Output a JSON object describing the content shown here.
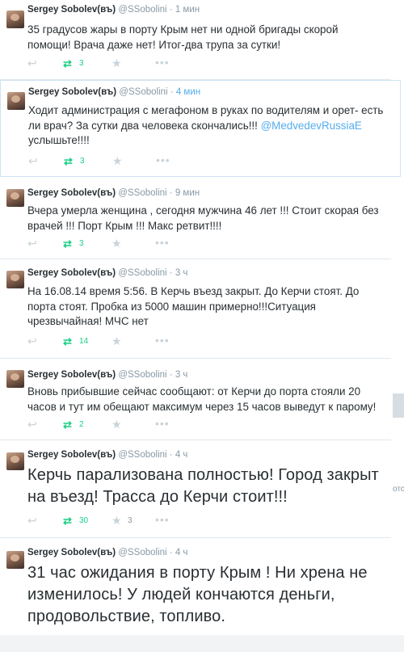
{
  "tweets": [
    {
      "name": "Sergey Sobolev(въ)",
      "handle": "@SSobolini",
      "time": "1 мин",
      "text": "35 градусов жары в порту Крым нет ни одной бригады скорой помощи! Врача даже нет! Итог-два трупа за сутки!",
      "retweets": "3",
      "favorites": ""
    },
    {
      "name": "Sergey Sobolev(въ)",
      "handle": "@SSobolini",
      "time": "4 мин",
      "text_before": "Ходит администрация с мегафоном в руках по водителям и орет- есть ли врач? За сутки два человека скончались!!! ",
      "mention": "@MedvedevRussiaE",
      "text_after": " услышьте!!!!",
      "retweets": "3",
      "favorites": ""
    },
    {
      "name": "Sergey Sobolev(въ)",
      "handle": "@SSobolini",
      "time": "9 мин",
      "text": "Вчера умерла женщина , сегодня мужчина 46 лет !!! Стоит скорая без врачей !!! Порт Крым !!! Макс ретвит!!!!",
      "retweets": "3",
      "favorites": ""
    },
    {
      "name": "Sergey Sobolev(въ)",
      "handle": "@SSobolini",
      "time": "3 ч",
      "text": "На 16.08.14 время 5:56. В Керчь въезд закрыт. До Керчи стоят. До порта стоят. Пробка из 5000 машин примерно!!!Ситуация чрезвычайная! МЧС нет",
      "retweets": "14",
      "favorites": ""
    },
    {
      "name": "Sergey Sobolev(въ)",
      "handle": "@SSobolini",
      "time": "3 ч",
      "text": "Вновь прибывшие сейчас сообщают: от Керчи до порта стояли 20 часов и тут им обещают максимум через 15 часов выведут к парому!",
      "retweets": "2",
      "favorites": ""
    },
    {
      "name": "Sergey Sobolev(въ)",
      "handle": "@SSobolini",
      "time": "4 ч",
      "text": "Керчь парализована полностью! Город закрыт на въезд! Трасса до Керчи стоит!!!",
      "retweets": "30",
      "favorites": "3"
    },
    {
      "name": "Sergey Sobolev(въ)",
      "handle": "@SSobolini",
      "time": "4 ч",
      "text": "31 час ожидания в порту Крым ! Ни хрена не изменилось! У людей кончаются деньги, продовольствие, топливо."
    }
  ],
  "edge_text": "отс",
  "icons": {
    "reply": "reply-icon",
    "retweet": "retweet-icon",
    "favorite": "star-icon",
    "more": "more-icon"
  }
}
